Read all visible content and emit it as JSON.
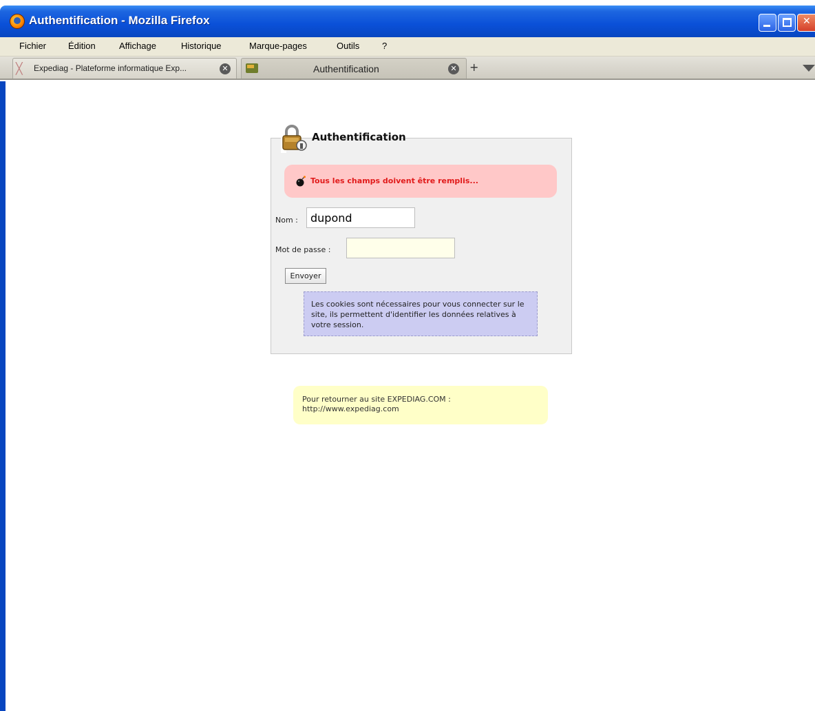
{
  "window": {
    "title": "Authentification - Mozilla Firefox"
  },
  "menu": {
    "items": [
      "Fichier",
      "Édition",
      "Affichage",
      "Historique",
      "Marque-pages",
      "Outils",
      "?"
    ]
  },
  "tabs": [
    {
      "label": "Expediag - Plateforme informatique Exp...",
      "active": false
    },
    {
      "label": "Authentification",
      "active": true
    }
  ],
  "newtab_label": "+",
  "auth": {
    "title": "Authentification",
    "error": "Tous les champs doivent être remplis...",
    "nom_label": "Nom :",
    "nom_value": "dupond",
    "password_label": "Mot de passe :",
    "password_value": "",
    "submit_label": "Envoyer",
    "cookie_notice": "Les cookies sont nécessaires pour vous connecter sur le site, ils permettent d'identifier les données relatives à votre session."
  },
  "return_notice": {
    "line1": "Pour retourner au site EXPEDIAG.COM :",
    "line2": "http://www.expediag.com"
  },
  "colors": {
    "titlebar": "#0a50d8",
    "error_bg": "#ffc8c8",
    "error_text": "#e11a1a",
    "cookie_bg": "#ccccf2",
    "return_bg": "#ffffc8"
  }
}
